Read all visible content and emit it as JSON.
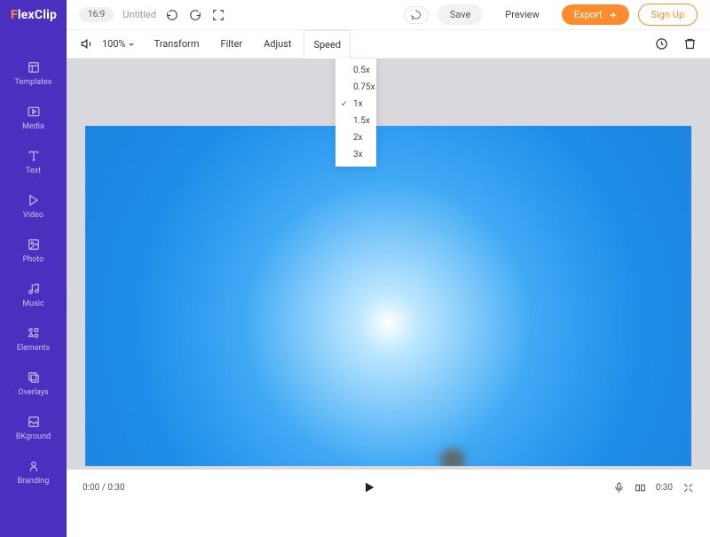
{
  "logo": {
    "prefix": "F",
    "rest": "lexClip"
  },
  "sidebar": {
    "items": [
      {
        "label": "Templates"
      },
      {
        "label": "Media"
      },
      {
        "label": "Text"
      },
      {
        "label": "Video"
      },
      {
        "label": "Photo"
      },
      {
        "label": "Music"
      },
      {
        "label": "Elements"
      },
      {
        "label": "Overlays"
      },
      {
        "label": "BKground"
      },
      {
        "label": "Branding"
      }
    ]
  },
  "topbar": {
    "ratio": "16:9",
    "title": "Untitled",
    "save": "Save",
    "preview": "Preview",
    "export": "Export",
    "signup": "Sign Up"
  },
  "toolbar": {
    "zoom": "100%",
    "tabs": {
      "transform": "Transform",
      "filter": "Filter",
      "adjust": "Adjust",
      "speed": "Speed"
    }
  },
  "speed_menu": {
    "selected_index": 2,
    "options": [
      "0.5x",
      "0.75x",
      "1x",
      "1.5x",
      "2x",
      "3x"
    ]
  },
  "playbar": {
    "time_current": "0:00",
    "time_total": "0:30",
    "duration_right": "0:30"
  }
}
